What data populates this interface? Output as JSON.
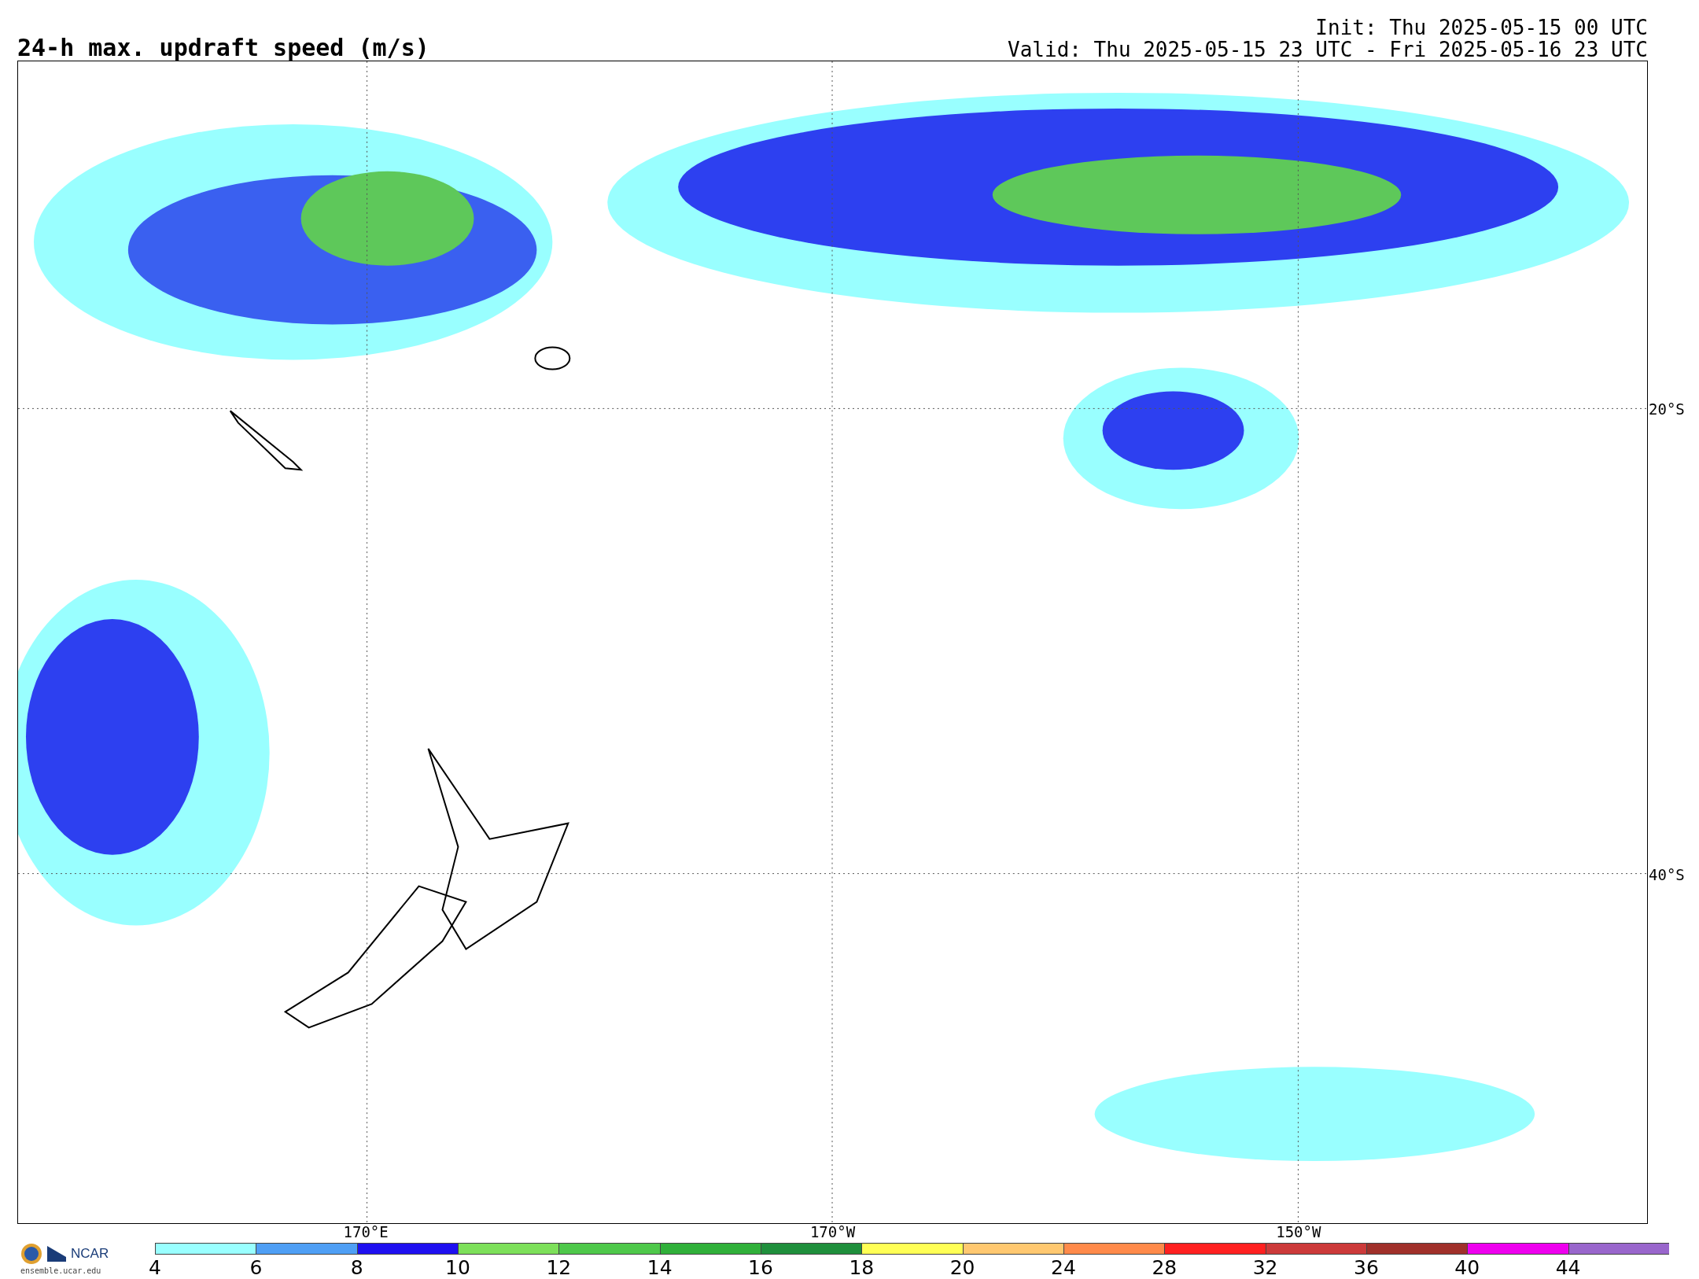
{
  "title": "24-h max. updraft speed (m/s)",
  "init": "Init: Thu 2025-05-15 00 UTC",
  "valid": "Valid: Thu 2025-05-15 23 UTC - Fri 2025-05-16 23 UTC",
  "lat_labels": [
    "20°S",
    "40°S"
  ],
  "lon_labels": [
    "170°E",
    "170°W",
    "150°W"
  ],
  "logo": {
    "name": "NCAR",
    "site": "ensemble.ucar.edu"
  },
  "colorbar": [
    {
      "label": "4",
      "color": "#99ffff"
    },
    {
      "label": "6",
      "color": "#4f9ff5"
    },
    {
      "label": "8",
      "color": "#1e10f0"
    },
    {
      "label": "10",
      "color": "#7de05a"
    },
    {
      "label": "12",
      "color": "#4ec84a"
    },
    {
      "label": "14",
      "color": "#30b03a"
    },
    {
      "label": "16",
      "color": "#1f8f3c"
    },
    {
      "label": "18",
      "color": "#ffff55"
    },
    {
      "label": "20",
      "color": "#ffc870"
    },
    {
      "label": "24",
      "color": "#ff8a4a"
    },
    {
      "label": "28",
      "color": "#ff2020"
    },
    {
      "label": "32",
      "color": "#cc3a3a"
    },
    {
      "label": "36",
      "color": "#a0302a"
    },
    {
      "label": "40",
      "color": "#ee00ee"
    },
    {
      "label": "44",
      "color": "#9966cc"
    }
  ]
}
